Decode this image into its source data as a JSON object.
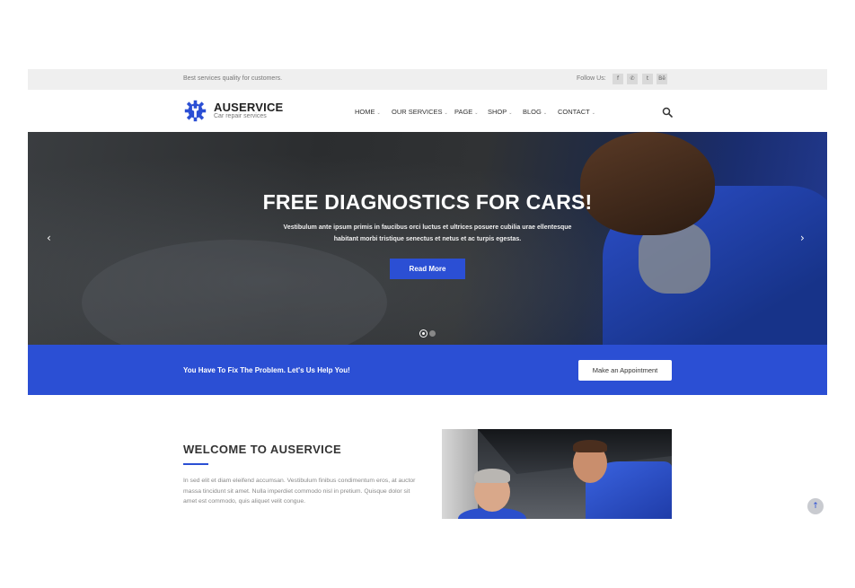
{
  "topbar": {
    "tagline": "Best services quality for customers.",
    "follow_label": "Follow Us:",
    "socials": [
      {
        "icon": "facebook-icon",
        "glyph": "f"
      },
      {
        "icon": "whatsapp-icon",
        "glyph": "✆"
      },
      {
        "icon": "twitter-icon",
        "glyph": "t"
      },
      {
        "icon": "behance-icon",
        "glyph": "Bē"
      }
    ]
  },
  "header": {
    "brand": "AUSERVICE",
    "brand_sub": "Car repair services",
    "nav": [
      {
        "label": "HOME"
      },
      {
        "label": "OUR SERVICES"
      },
      {
        "label": "PAGE"
      },
      {
        "label": "SHOP"
      },
      {
        "label": "BLOG"
      },
      {
        "label": "CONTACT"
      }
    ]
  },
  "hero": {
    "title": "FREE DIAGNOSTICS FOR CARS!",
    "text": "Vestibulum ante ipsum primis in faucibus orci luctus et ultrices posuere cubilia urae ellentesque habitant morbi tristique senectus et netus et ac turpis egestas.",
    "button": "Read More",
    "prev_glyph": "‹",
    "next_glyph": "›",
    "active_slide": 1,
    "slide_count": 2
  },
  "cta": {
    "message": "You Have To Fix The Problem. Let's Us Help You!",
    "button": "Make an Appointment"
  },
  "welcome": {
    "title": "WELCOME TO AUSERVICE",
    "text": "In sed elit et diam eleifend accumsan. Vestibulum finibus condimentum eros, at auctor massa tincidunt sit amet. Nulla imperdiet commodo nisl in pretium. Quisque dolor sit amet est commodo, quis aliquet velit congue."
  },
  "scroll_top_glyph": "↑",
  "colors": {
    "accent": "#2b4fd4",
    "topbar_bg": "#efefef"
  }
}
